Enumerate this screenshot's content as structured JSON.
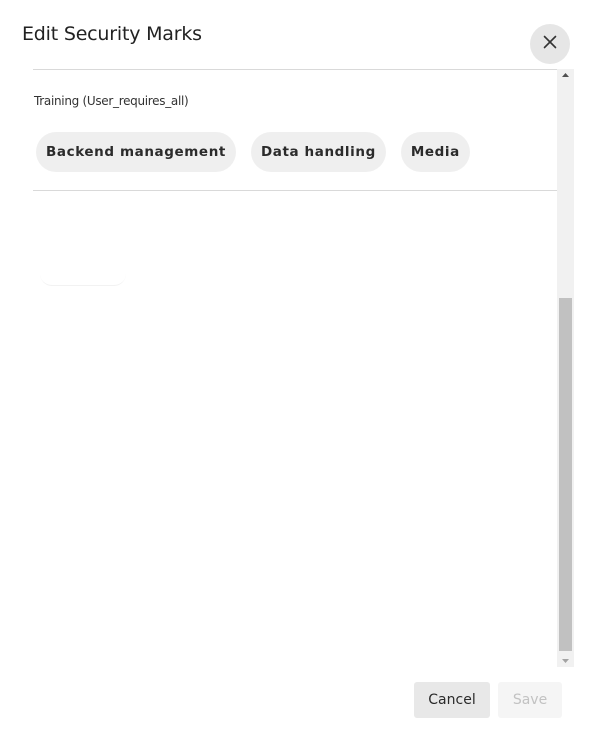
{
  "dialog": {
    "title": "Edit Security Marks",
    "close_icon": "close-icon"
  },
  "group": {
    "label": "Training (User_requires_all)",
    "chips": [
      {
        "label": "Backend management"
      },
      {
        "label": "Data handling"
      },
      {
        "label": "Media"
      }
    ]
  },
  "footer": {
    "cancel_label": "Cancel",
    "save_label": "Save"
  }
}
